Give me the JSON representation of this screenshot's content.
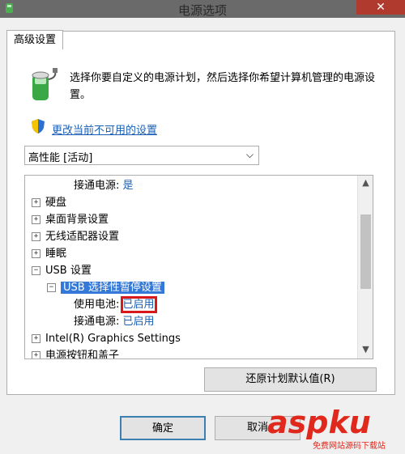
{
  "window": {
    "title": "电源选项",
    "close_label": "✕"
  },
  "tab": {
    "label": "高级设置"
  },
  "description": "选择你要自定义的电源计划，然后选择你希望计算机管理的电源设置。",
  "change_link": "更改当前不可用的设置",
  "plan_select": {
    "value": "高性能 [活动]"
  },
  "tree": {
    "rows": [
      {
        "label": "接通电源:",
        "value": "是"
      },
      {
        "label": "硬盘"
      },
      {
        "label": "桌面背景设置"
      },
      {
        "label": "无线适配器设置"
      },
      {
        "label": "睡眠"
      },
      {
        "label": "USB 设置"
      },
      {
        "label": "USB 选择性暂停设置"
      },
      {
        "label": "使用电池:",
        "value": "已启用"
      },
      {
        "label": "接通电源:",
        "value": "已启用"
      },
      {
        "label": "Intel(R) Graphics Settings"
      },
      {
        "label": "电源按钮和盖子"
      }
    ]
  },
  "buttons": {
    "restore": "还原计划默认值(R)",
    "ok": "确定",
    "cancel": "取消"
  },
  "watermark": {
    "brand": "aspku",
    "sub": "免费网站源码下载站"
  },
  "colors": {
    "link": "#1a5fb4",
    "selection": "#3478d8",
    "highlight_box": "#d7191c"
  }
}
